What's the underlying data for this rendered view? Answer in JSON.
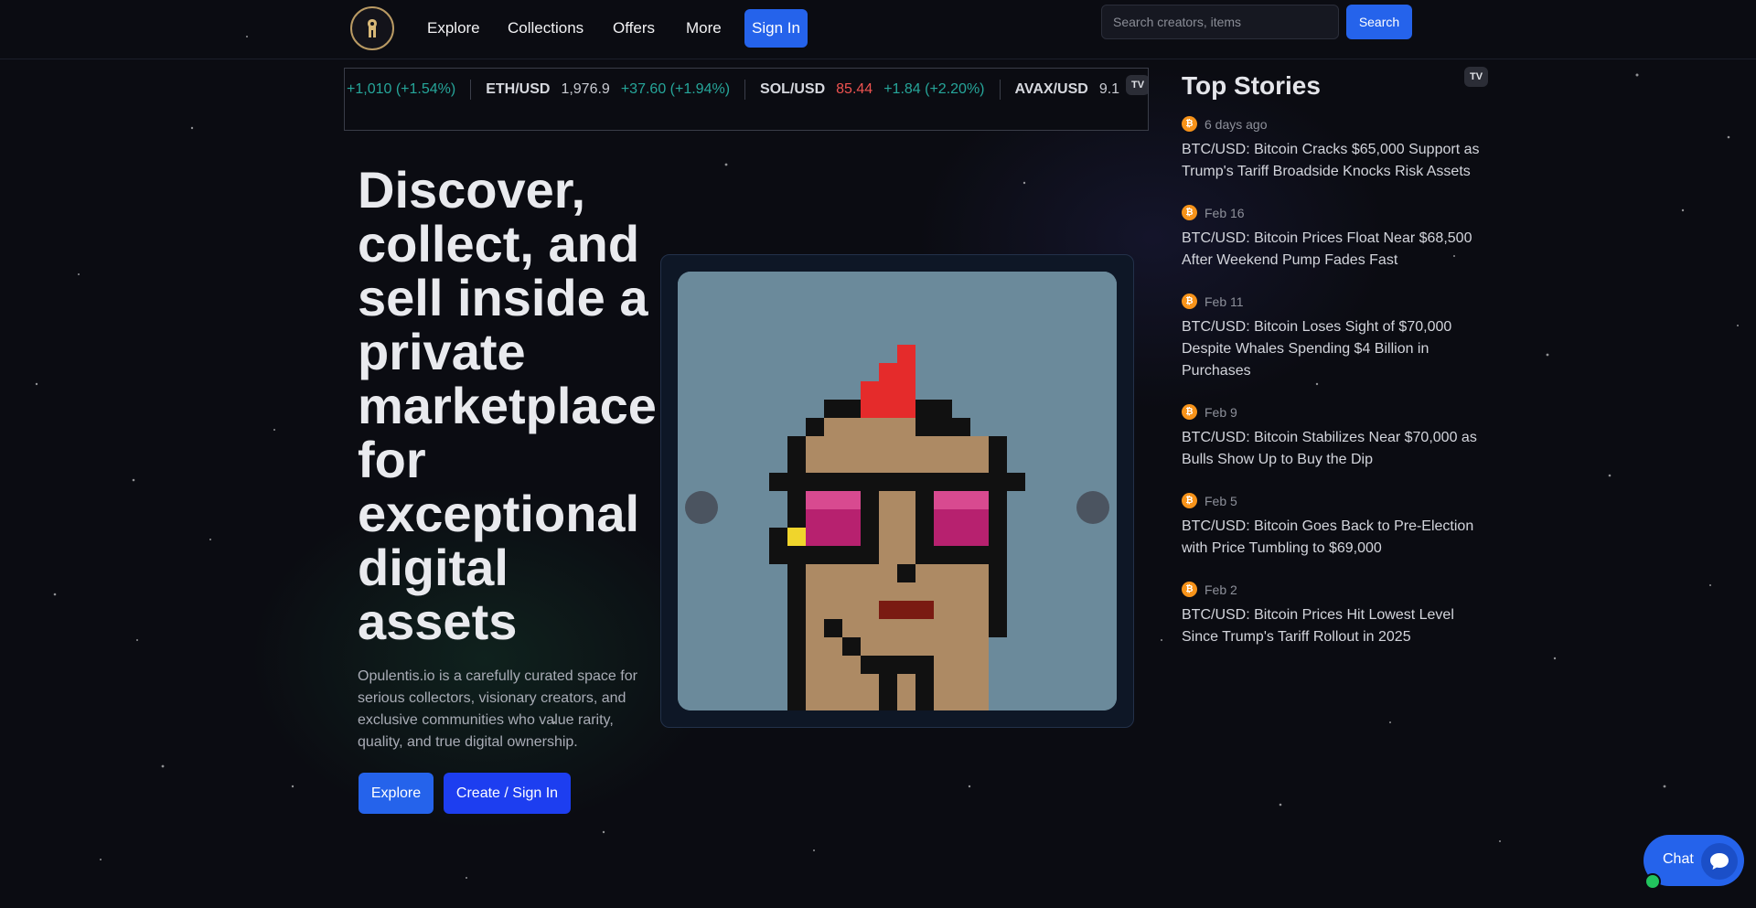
{
  "nav": {
    "links": [
      "Explore",
      "Collections",
      "Offers",
      "More"
    ],
    "sign_in": "Sign In",
    "search_placeholder": "Search creators, items",
    "search_button": "Search"
  },
  "ticker": {
    "items": [
      {
        "symbol": "",
        "price": "",
        "change": "+1,010 (+1.54%)",
        "direction": "up"
      },
      {
        "symbol": "ETH/USD",
        "price": "1,976.9",
        "change": "+37.60 (+1.94%)",
        "direction": "up"
      },
      {
        "symbol": "SOL/USD",
        "price": "85.44",
        "change": "+1.84 (+2.20%)",
        "direction": "up"
      },
      {
        "symbol": "AVAX/USD",
        "price": "9.1",
        "change": "",
        "direction": "up"
      }
    ],
    "badge": "TV"
  },
  "hero": {
    "title": "Discover, collect, and sell inside a private marketplace for exceptional digital assets",
    "description": "Opulentis.io is a carefully curated space for serious collectors, visionary creators, and exclusive communities who value rarity, quality, and true digital ownership.",
    "explore_button": "Explore",
    "create_button": "Create / Sign In"
  },
  "carousel": {
    "prev_label": "",
    "next_label": "",
    "slide_count": 12,
    "active_slide": 1
  },
  "stories": {
    "title": "Top Stories",
    "badge": "TV",
    "items": [
      {
        "time": "6 days ago",
        "headline": "BTC/USD: Bitcoin Cracks $65,000 Support as Trump's Tariff Broadside Knocks Risk Assets"
      },
      {
        "time": "Feb 16",
        "headline": "BTC/USD: Bitcoin Prices Float Near $68,500 After Weekend Pump Fades Fast"
      },
      {
        "time": "Feb 11",
        "headline": "BTC/USD: Bitcoin Loses Sight of $70,000 Despite Whales Spending $4 Billion in Purchases"
      },
      {
        "time": "Feb 9",
        "headline": "BTC/USD: Bitcoin Stabilizes Near $70,000 as Bulls Show Up to Buy the Dip"
      },
      {
        "time": "Feb 5",
        "headline": "BTC/USD: Bitcoin Goes Back to Pre-Election with Price Tumbling to $69,000"
      },
      {
        "time": "Feb 2",
        "headline": "BTC/USD: Bitcoin Prices Hit Lowest Level Since Trump's Tariff Rollout in 2025"
      }
    ]
  },
  "chat": {
    "label": "Chat"
  },
  "colors": {
    "accent": "#2563eb",
    "up": "#26a69a",
    "down": "#ef5350",
    "bitcoin": "#f7931a"
  }
}
